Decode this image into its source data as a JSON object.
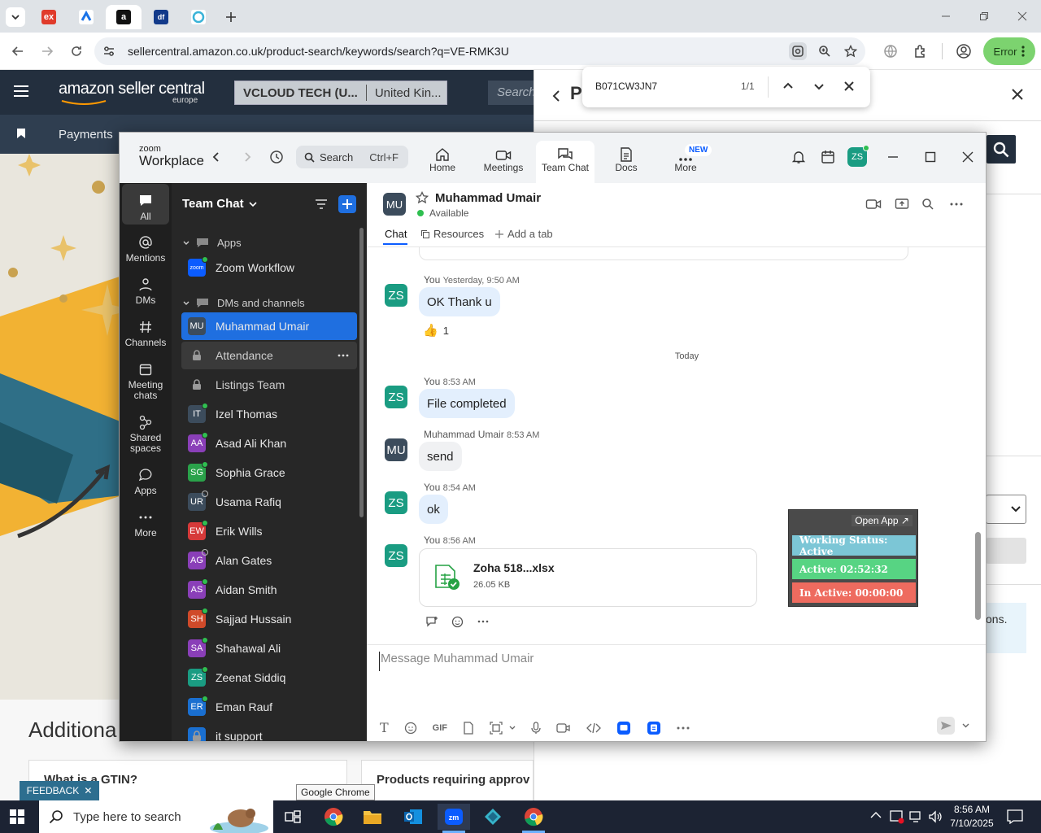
{
  "browser": {
    "url": "sellercentral.amazon.co.uk/product-search/keywords/search?q=VE-RMK3U",
    "profile_button": "Error",
    "find": {
      "query": "B071CW3JN7",
      "count": "1/1"
    },
    "tooltip": "Google Chrome"
  },
  "amazon": {
    "logo_main": "amazon seller central",
    "logo_sub": "europe",
    "account_selector": "VCLOUD TECH (U...",
    "marketplace": "United Kin...",
    "search_placeholder": "Search",
    "nav_item": "Payments",
    "section_heading": "Additiona",
    "card1_title": "What is a GTIN?",
    "card2_title": "Products requiring approv",
    "feedback": "FEEDBACK",
    "right_panel_title": "P",
    "right_panel_text": "ons."
  },
  "zoom": {
    "brand_top": "zoom",
    "brand_bottom": "Workplace",
    "search": {
      "label": "Search",
      "shortcut": "Ctrl+F"
    },
    "topnav": [
      {
        "label": "Home"
      },
      {
        "label": "Meetings"
      },
      {
        "label": "Team Chat"
      },
      {
        "label": "Docs"
      },
      {
        "label": "More",
        "badge": "NEW"
      }
    ],
    "user_initials": "ZS",
    "rail": [
      {
        "label": "All"
      },
      {
        "label": "Mentions"
      },
      {
        "label": "DMs"
      },
      {
        "label": "Channels"
      },
      {
        "label": "Meeting chats"
      },
      {
        "label": "Shared spaces"
      },
      {
        "label": "Apps"
      },
      {
        "label": "More"
      }
    ],
    "list_title": "Team Chat",
    "sections": {
      "apps": "Apps",
      "dms": "DMs and channels"
    },
    "app_item": "Zoom Workflow",
    "contacts": [
      {
        "initials": "MU",
        "name": "Muhammad Umair",
        "color": "#3c4c5c"
      },
      {
        "initials": "",
        "name": "Attendance",
        "color": ""
      },
      {
        "initials": "",
        "name": "Listings Team",
        "color": ""
      },
      {
        "initials": "IT",
        "name": "Izel Thomas",
        "color": "#3c4c5c"
      },
      {
        "initials": "AA",
        "name": "Asad Ali Khan",
        "color": "#8a3fb8"
      },
      {
        "initials": "SG",
        "name": "Sophia Grace",
        "color": "#2aa24a"
      },
      {
        "initials": "UR",
        "name": "Usama Rafiq",
        "color": "#3c4c5c"
      },
      {
        "initials": "EW",
        "name": "Erik Wills",
        "color": "#d63a3a"
      },
      {
        "initials": "AG",
        "name": "Alan Gates",
        "color": "#8a3fb8"
      },
      {
        "initials": "AS",
        "name": "Aidan Smith",
        "color": "#8a3fb8"
      },
      {
        "initials": "SH",
        "name": "Sajjad Hussain",
        "color": "#d04a2a"
      },
      {
        "initials": "SA",
        "name": "Shahawal Ali",
        "color": "#8a3fb8"
      },
      {
        "initials": "ZS",
        "name": "Zeenat Siddiq",
        "color": "#1a9c82"
      },
      {
        "initials": "ER",
        "name": "Eman Rauf",
        "color": "#1a6fd0"
      },
      {
        "initials": "",
        "name": "it support",
        "color": "#1a6fd0"
      }
    ],
    "chat": {
      "avatar": "MU",
      "name": "Muhammad Umair",
      "status": "Available",
      "tabs": {
        "chat": "Chat",
        "resources": "Resources",
        "add": "Add a tab"
      },
      "day_divider": "Today",
      "messages": [
        {
          "avatar": "ZS",
          "sender": "You",
          "time": "Yesterday, 9:50 AM",
          "text": "OK Thank u",
          "reaction": "1"
        },
        {
          "avatar": "ZS",
          "sender": "You",
          "time": "8:53 AM",
          "text": "File completed"
        },
        {
          "avatar": "MU",
          "sender": "Muhammad Umair",
          "time": "8:53 AM",
          "text": "send"
        },
        {
          "avatar": "ZS",
          "sender": "You",
          "time": "8:54 AM",
          "text": "ok"
        },
        {
          "avatar": "ZS",
          "sender": "You",
          "time": "8:56 AM"
        }
      ],
      "file": {
        "name": "Zoha 518...xlsx",
        "size": "26.05 KB"
      },
      "composer_placeholder": "Message Muhammad Umair",
      "composer_gif": "GIF"
    },
    "work_status": {
      "open_app": "Open App ↗",
      "status": "Working Status: Active",
      "active": "Active: 02:52:32",
      "inactive": "In Active: 00:00:00"
    }
  },
  "taskbar": {
    "search_placeholder": "Type here to search",
    "time": "8:56 AM",
    "date": "7/10/2025"
  }
}
